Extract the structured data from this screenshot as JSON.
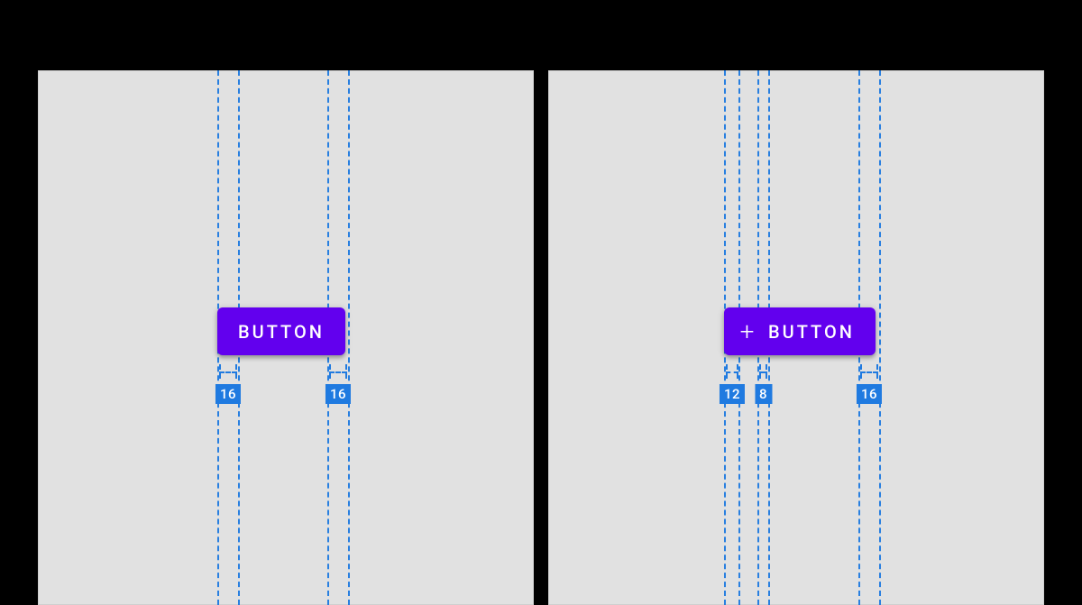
{
  "colors": {
    "button_bg": "#6200ee",
    "guide": "#1f7ae0",
    "panel_bg": "#e1e1e1"
  },
  "panel_a": {
    "button_label": "BUTTON",
    "measures": {
      "left_padding": "16",
      "right_padding": "16"
    }
  },
  "panel_b": {
    "button_label": "BUTTON",
    "icon_name": "plus-icon",
    "icon_glyph": "+",
    "measures": {
      "left_padding": "12",
      "icon_gap": "8",
      "right_padding": "16"
    }
  }
}
